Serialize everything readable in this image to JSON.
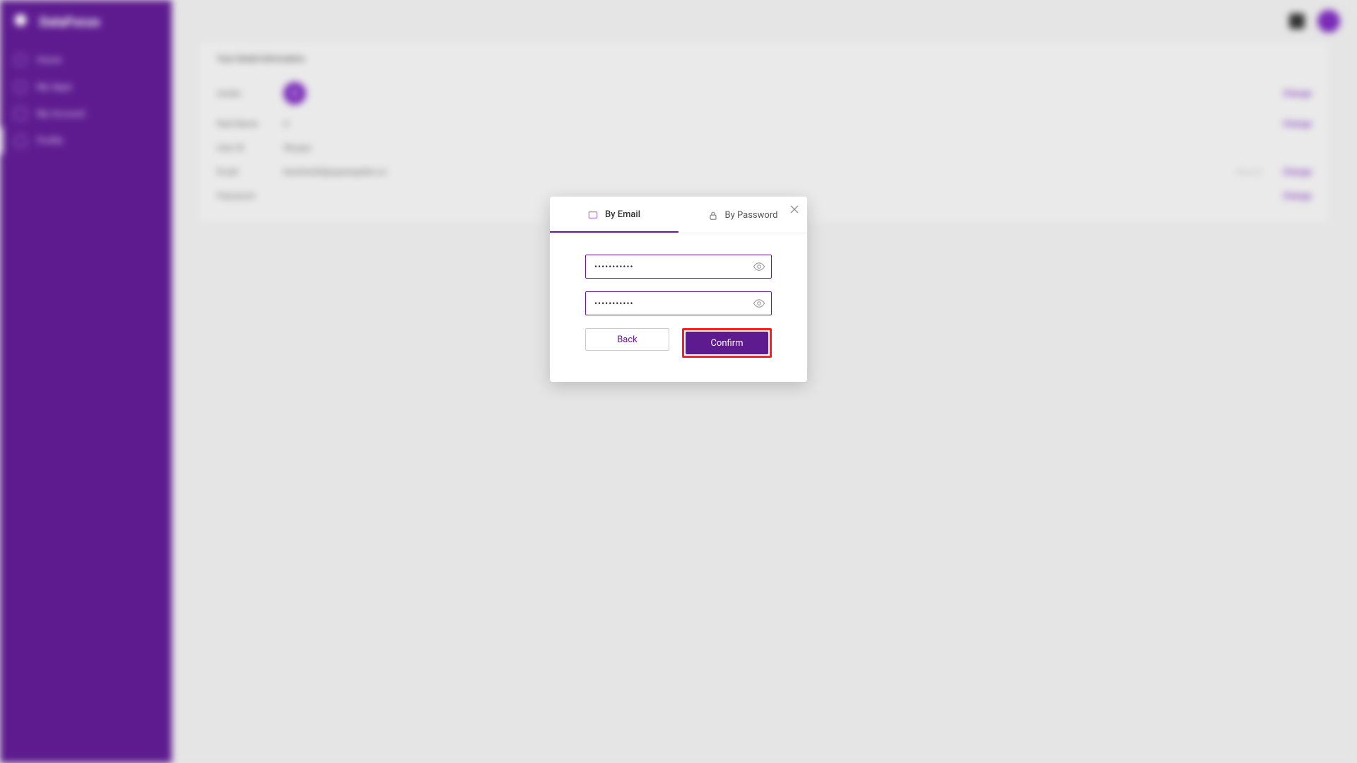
{
  "app": {
    "name": "DataFocus"
  },
  "sidebar": {
    "items": [
      {
        "label": "Home"
      },
      {
        "label": "My Apps"
      },
      {
        "label": "My Account"
      },
      {
        "label": "Profile"
      }
    ]
  },
  "topbar": {
    "avatar_initial": "D"
  },
  "panel": {
    "title": "Your Detail Information",
    "avatar_label": "Avatar",
    "avatar_initial": "D",
    "avatar_action": "Change",
    "real_name_label": "Real Name",
    "real_name_value": "d",
    "real_name_action": "Change",
    "user_id_label": "User ID",
    "user_id_value": "Shuyao",
    "email_label": "Email",
    "email_value": "karolina30@sparespitter.cn",
    "email_status": "Bound",
    "email_action": "Change",
    "password_label": "Password",
    "password_action": "Change"
  },
  "modal": {
    "tabs": {
      "email": "By Email",
      "password": "By Password"
    },
    "field1_value": "•••••••••••",
    "field2_value": "•••••••••••",
    "back": "Back",
    "confirm": "Confirm"
  }
}
